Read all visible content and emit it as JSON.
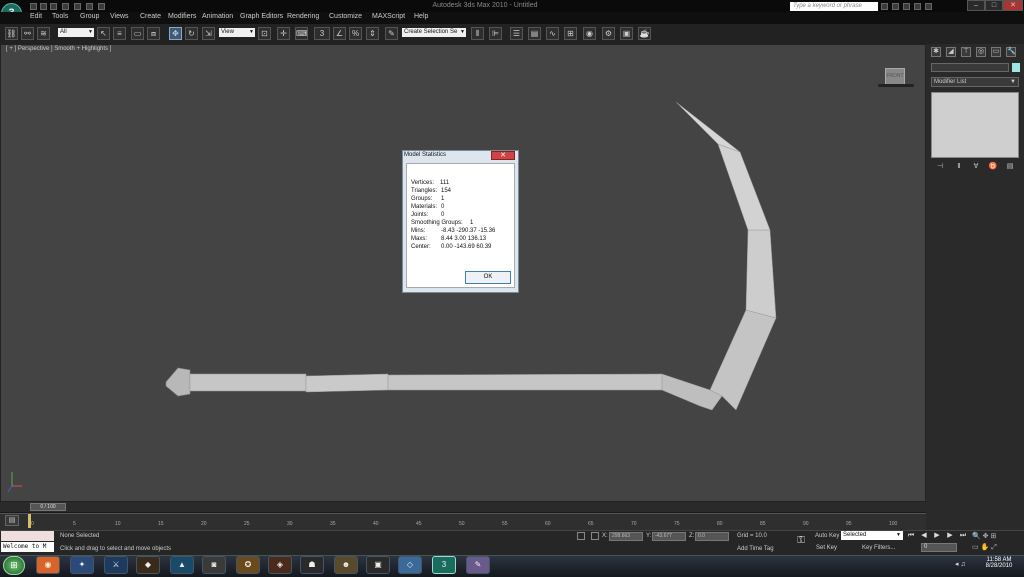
{
  "app": {
    "title": "Autodesk 3ds Max 2010 - Untitled",
    "logo": "3ds-max-logo"
  },
  "search": {
    "placeholder": "Type a keyword or phrase"
  },
  "menu": [
    "Edit",
    "Tools",
    "Group",
    "Views",
    "Create",
    "Modifiers",
    "Animation",
    "Graph Editors",
    "Rendering",
    "Customize",
    "MAXScript",
    "Help"
  ],
  "toolbar": {
    "selection_filter": "All",
    "reference_coord": "View",
    "named_selection": "Create Selection Se",
    "snap_value": "3"
  },
  "viewport": {
    "label": "[ + ] Perspective ] Smooth + Highlights ]",
    "object_color": "#c8c8c8",
    "background": "#444444"
  },
  "dialog": {
    "title": "Model Statistics",
    "close": "✕",
    "ok": "OK",
    "stats": [
      {
        "label": "Vertices:",
        "value": "111"
      },
      {
        "label": "Triangles:",
        "value": "154"
      },
      {
        "label": "Groups:",
        "value": "1"
      },
      {
        "label": "Materials:",
        "value": "0"
      },
      {
        "label": "Joints:",
        "value": "0"
      },
      {
        "label": "Smoothing Groups:",
        "value": "1"
      },
      {
        "label": "Mins:",
        "value": "-8.43 -290.37 -15.36"
      },
      {
        "label": "Maxs:",
        "value": "8.44 3.00 136.13"
      },
      {
        "label": "Center:",
        "value": "0.00 -143.69 60.39"
      }
    ]
  },
  "command_panel": {
    "modifier_list": "Modifier List",
    "swatch_color": "#9ee6e2"
  },
  "timeline": {
    "frame_display": "0 / 100",
    "ticks": [
      "0",
      "5",
      "10",
      "15",
      "20",
      "25",
      "30",
      "35",
      "40",
      "45",
      "50",
      "55",
      "60",
      "65",
      "70",
      "75",
      "80",
      "85",
      "90",
      "95",
      "100"
    ]
  },
  "status": {
    "listener_text": "Welcome to M",
    "selection": "None Selected",
    "prompt": "Click and drag to select and move objects",
    "x_value": "298.663",
    "y_value": "-43.677",
    "z_value": "0.0",
    "x_label": "X:",
    "y_label": "Y:",
    "z_label": "Z:",
    "grid": "Grid = 10.0",
    "add_time_tag": "Add Time Tag",
    "auto_key": "Auto Key",
    "set_key": "Set Key",
    "key_mode": "Selected",
    "key_filters": "Key Filters...",
    "current_frame": "0"
  },
  "taskbar": {
    "time": "11:58 AM",
    "date": "8/28/2010"
  }
}
